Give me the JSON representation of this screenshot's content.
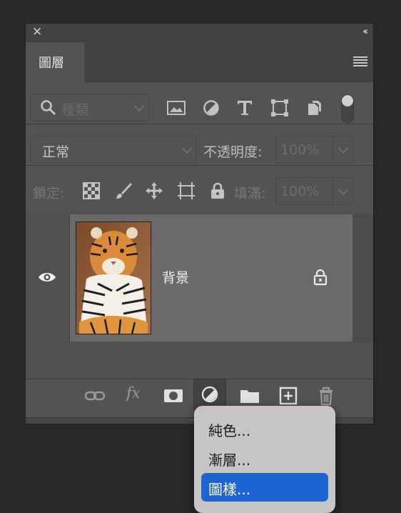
{
  "panel": {
    "close_glyph": "✕",
    "collapse_glyph": "‹‹",
    "tab_label": "圖層"
  },
  "filter": {
    "kind_placeholder": "種類",
    "icons": [
      "image-filter-icon",
      "adjustment-filter-icon",
      "type-filter-icon",
      "shape-filter-icon",
      "smart-object-filter-icon"
    ]
  },
  "blend": {
    "mode": "正常",
    "opacity_label": "不透明度:",
    "opacity_value": "100%"
  },
  "lock": {
    "label": "鎖定:",
    "fill_label": "填滿:",
    "fill_value": "100%"
  },
  "layers": [
    {
      "name": "背景",
      "visible": true,
      "locked": true
    }
  ],
  "menu": {
    "items": [
      {
        "label": "純色..."
      },
      {
        "label": "漸層..."
      },
      {
        "label": "圖樣..."
      }
    ],
    "selected_index": 2
  },
  "colors": {
    "panel_bg": "#535353",
    "selected_layer": "#6a6a6a",
    "menu_highlight": "#1e63d2"
  }
}
